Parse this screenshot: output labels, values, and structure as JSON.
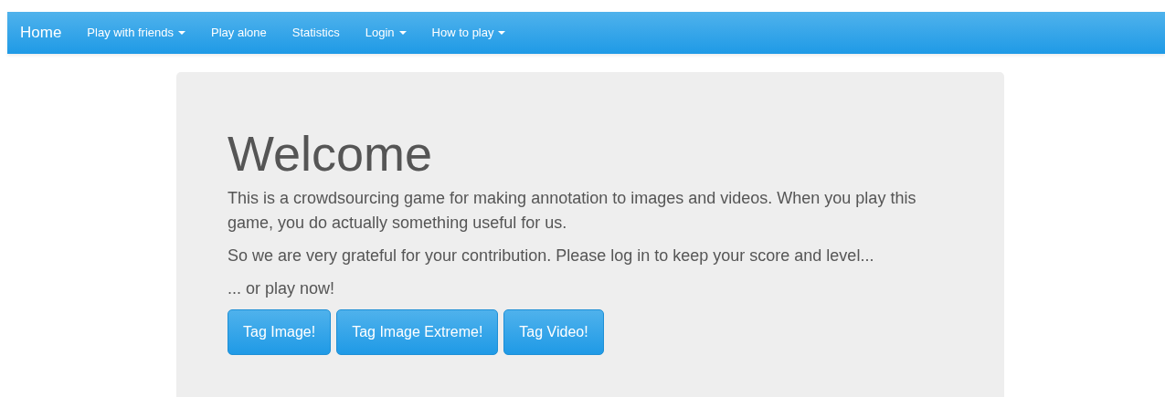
{
  "navbar": {
    "brand": "Home",
    "items": [
      {
        "label": "Play with friends",
        "dropdown": true
      },
      {
        "label": "Play alone",
        "dropdown": false
      },
      {
        "label": "Statistics",
        "dropdown": false
      },
      {
        "label": "Login",
        "dropdown": true
      },
      {
        "label": "How to play",
        "dropdown": true
      }
    ]
  },
  "jumbotron": {
    "heading": "Welcome",
    "paragraphs": [
      "This is a crowdsourcing game for making annotation to images and videos. When you play this game, you do actually something useful for us.",
      "So we are very grateful for your contribution. Please log in to keep your score and level...",
      "... or play now!"
    ],
    "buttons": [
      "Tag Image!",
      "Tag Image Extreme!",
      "Tag Video!"
    ]
  }
}
